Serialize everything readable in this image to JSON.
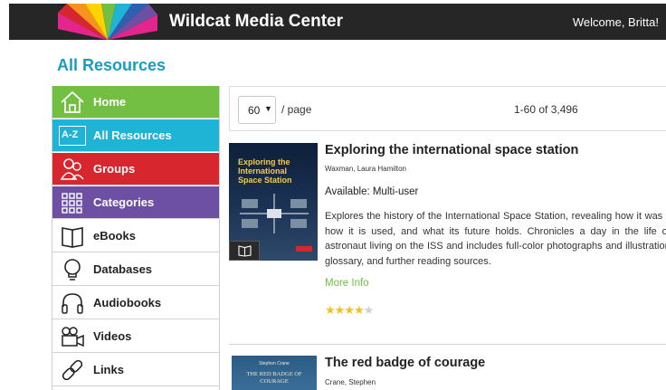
{
  "header": {
    "brand": "Wildcat Media Center",
    "welcome": "Welcome, Britta!"
  },
  "page_title": "All Resources",
  "sidebar": {
    "items": [
      {
        "label": "Home",
        "icon": "home-icon",
        "bg": "#72bf44"
      },
      {
        "label": "All Resources",
        "icon": "a-z-icon",
        "icon_text": "A-Z",
        "bg": "#1fb4d6"
      },
      {
        "label": "Groups",
        "icon": "groups-icon",
        "bg": "#d7262e"
      },
      {
        "label": "Categories",
        "icon": "grid-icon",
        "bg": "#6d4fa3"
      },
      {
        "label": "eBooks",
        "icon": "book-icon"
      },
      {
        "label": "Databases",
        "icon": "lightbulb-icon"
      },
      {
        "label": "Audiobooks",
        "icon": "headphones-icon"
      },
      {
        "label": "Videos",
        "icon": "video-camera-icon"
      },
      {
        "label": "Links",
        "icon": "link-icon"
      }
    ]
  },
  "toolbar": {
    "per_page_value": "60",
    "per_page_label": "/ page",
    "range": "1-60 of 3,496"
  },
  "results": [
    {
      "title": "Exploring the international space station",
      "author": "Waxman, Laura Hamilton",
      "availability": "Available: Multi-user",
      "description": "Explores the history of the International Space Station, revealing how it was built, how it is used, and what its future holds. Chronicles a day in the life of an astronaut living on the ISS and includes full-color photographs and illustrations, a glossary, and further reading sources.",
      "more_info": "More Info",
      "rating": 4,
      "rating_max": 5,
      "cover_text": "Exploring the International Space Station",
      "format_icon": "book-icon"
    },
    {
      "title": "The red badge of courage",
      "author": "Crane, Stephen",
      "cover_author": "Stephen Crane",
      "cover_text": "THE RED BADGE OF COURAGE"
    }
  ],
  "colors": {
    "topbar": "#262626",
    "title_blue": "#1a9bc4",
    "link_green": "#6fbf3f",
    "star": "#f2c21a"
  }
}
